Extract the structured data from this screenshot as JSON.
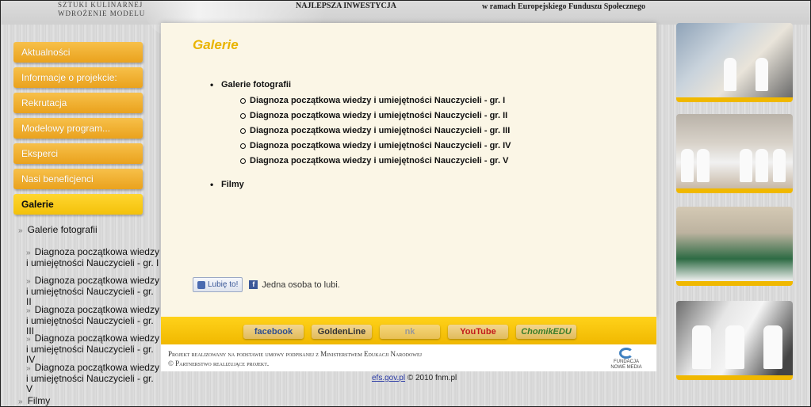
{
  "header": {
    "brand_line1": "Sztuki kulinarnej",
    "brand_line2": "wdrożenie modelu",
    "slogan": "Najlepsza inwestycja",
    "efs_note": "w ramach Europejskiego Funduszu Społecznego"
  },
  "nav": {
    "items": [
      {
        "label": "Aktualności"
      },
      {
        "label": "Informacje o projekcie:"
      },
      {
        "label": "Rekrutacja"
      },
      {
        "label": "Modelowy program..."
      },
      {
        "label": "Eksperci"
      },
      {
        "label": "Nasi beneficjenci"
      },
      {
        "label": "Galerie"
      }
    ],
    "active": "Galerie"
  },
  "subnav": {
    "chevron": "»",
    "gallery_label": "Galerie fotografii",
    "children": [
      "Diagnoza początkowa wiedzy i umiejętności Nauczycieli - gr. I",
      "Diagnoza początkowa wiedzy i umiejętności Nauczycieli - gr. II",
      "Diagnoza początkowa wiedzy i umiejętności Nauczycieli - gr. III",
      "Diagnoza początkowa wiedzy i umiejętności Nauczycieli - gr. IV",
      "Diagnoza początkowa wiedzy i umiejętności Nauczycieli - gr. V"
    ],
    "films_label": "Filmy"
  },
  "main": {
    "title": "Galerie",
    "gallery_label": "Galerie fotografii",
    "links": [
      "Diagnoza początkowa wiedzy i umiejętności Nauczycieli - gr. I",
      "Diagnoza początkowa wiedzy i umiejętności Nauczycieli - gr. II",
      "Diagnoza początkowa wiedzy i umiejętności Nauczycieli - gr. III",
      "Diagnoza początkowa wiedzy i umiejętności Nauczycieli - gr. IV",
      "Diagnoza początkowa wiedzy i umiejętności Nauczycieli - gr. V"
    ],
    "films_label": "Filmy",
    "like_button": "Lubię to!",
    "like_text": "Jedna osoba to lubi."
  },
  "footer": {
    "social": [
      "facebook",
      "GoldenLine",
      "nk",
      "YouTube",
      "ChomikEDU"
    ],
    "legal_line1": "Projekt realizowany na podstawie umowy podpisanej z Ministerstwem Edukacji Narodowej",
    "legal_line2": "© Partnerstwo realizujące projekt.",
    "fundacja_line1": "FUNDACJA",
    "fundacja_line2": "NOWE MEDIA",
    "copyright_link": "efs.gov.pl",
    "copyright_text": "© 2010 fnm.pl"
  },
  "colors": {
    "accent": "#f0b800",
    "nav_orange": "#eaa21d",
    "title_gold": "#e9b400",
    "content_bg": "#fbf6e6"
  }
}
